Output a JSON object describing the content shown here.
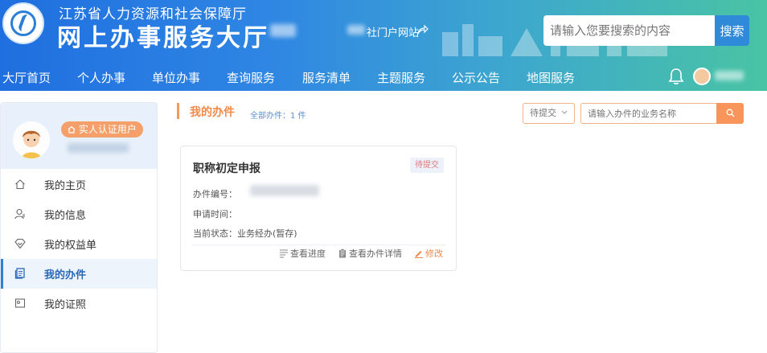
{
  "header": {
    "brand_sub": "江苏省人力资源和社会保障厅",
    "brand_main": "网上办事服务大厅",
    "portal_link": "社门户网站",
    "search_placeholder": "请输入您要搜索的内容",
    "search_button": "搜索"
  },
  "nav": {
    "items": [
      "大厅首页",
      "个人办事",
      "单位办事",
      "查询服务",
      "服务清单",
      "主题服务",
      "公示公告",
      "地图服务"
    ]
  },
  "sidebar": {
    "cert_badge": "实人认证用户",
    "menu": [
      {
        "label": "我的主页",
        "icon": "home-icon"
      },
      {
        "label": "我的信息",
        "icon": "user-icon"
      },
      {
        "label": "我的权益单",
        "icon": "shield-icon"
      },
      {
        "label": "我的办件",
        "icon": "document-icon",
        "active": true
      },
      {
        "label": "我的证照",
        "icon": "license-icon"
      }
    ]
  },
  "main": {
    "section_title": "我的办件",
    "section_count": "全部办件：1 件",
    "status_filter": "待提交",
    "search_placeholder": "请输入办件的业务名称"
  },
  "card": {
    "title": "职称初定申报",
    "status": "待提交",
    "number_label": "办件编号：",
    "time_label": "申请时间：",
    "state_label": "当前状态：",
    "state_value": "业务经办(暂存)",
    "action_progress": "查看进度",
    "action_detail": "查看办件详情",
    "action_edit": "修改"
  },
  "colors": {
    "accent_orange": "#f08a4b",
    "primary_blue": "#2f7fd6"
  }
}
